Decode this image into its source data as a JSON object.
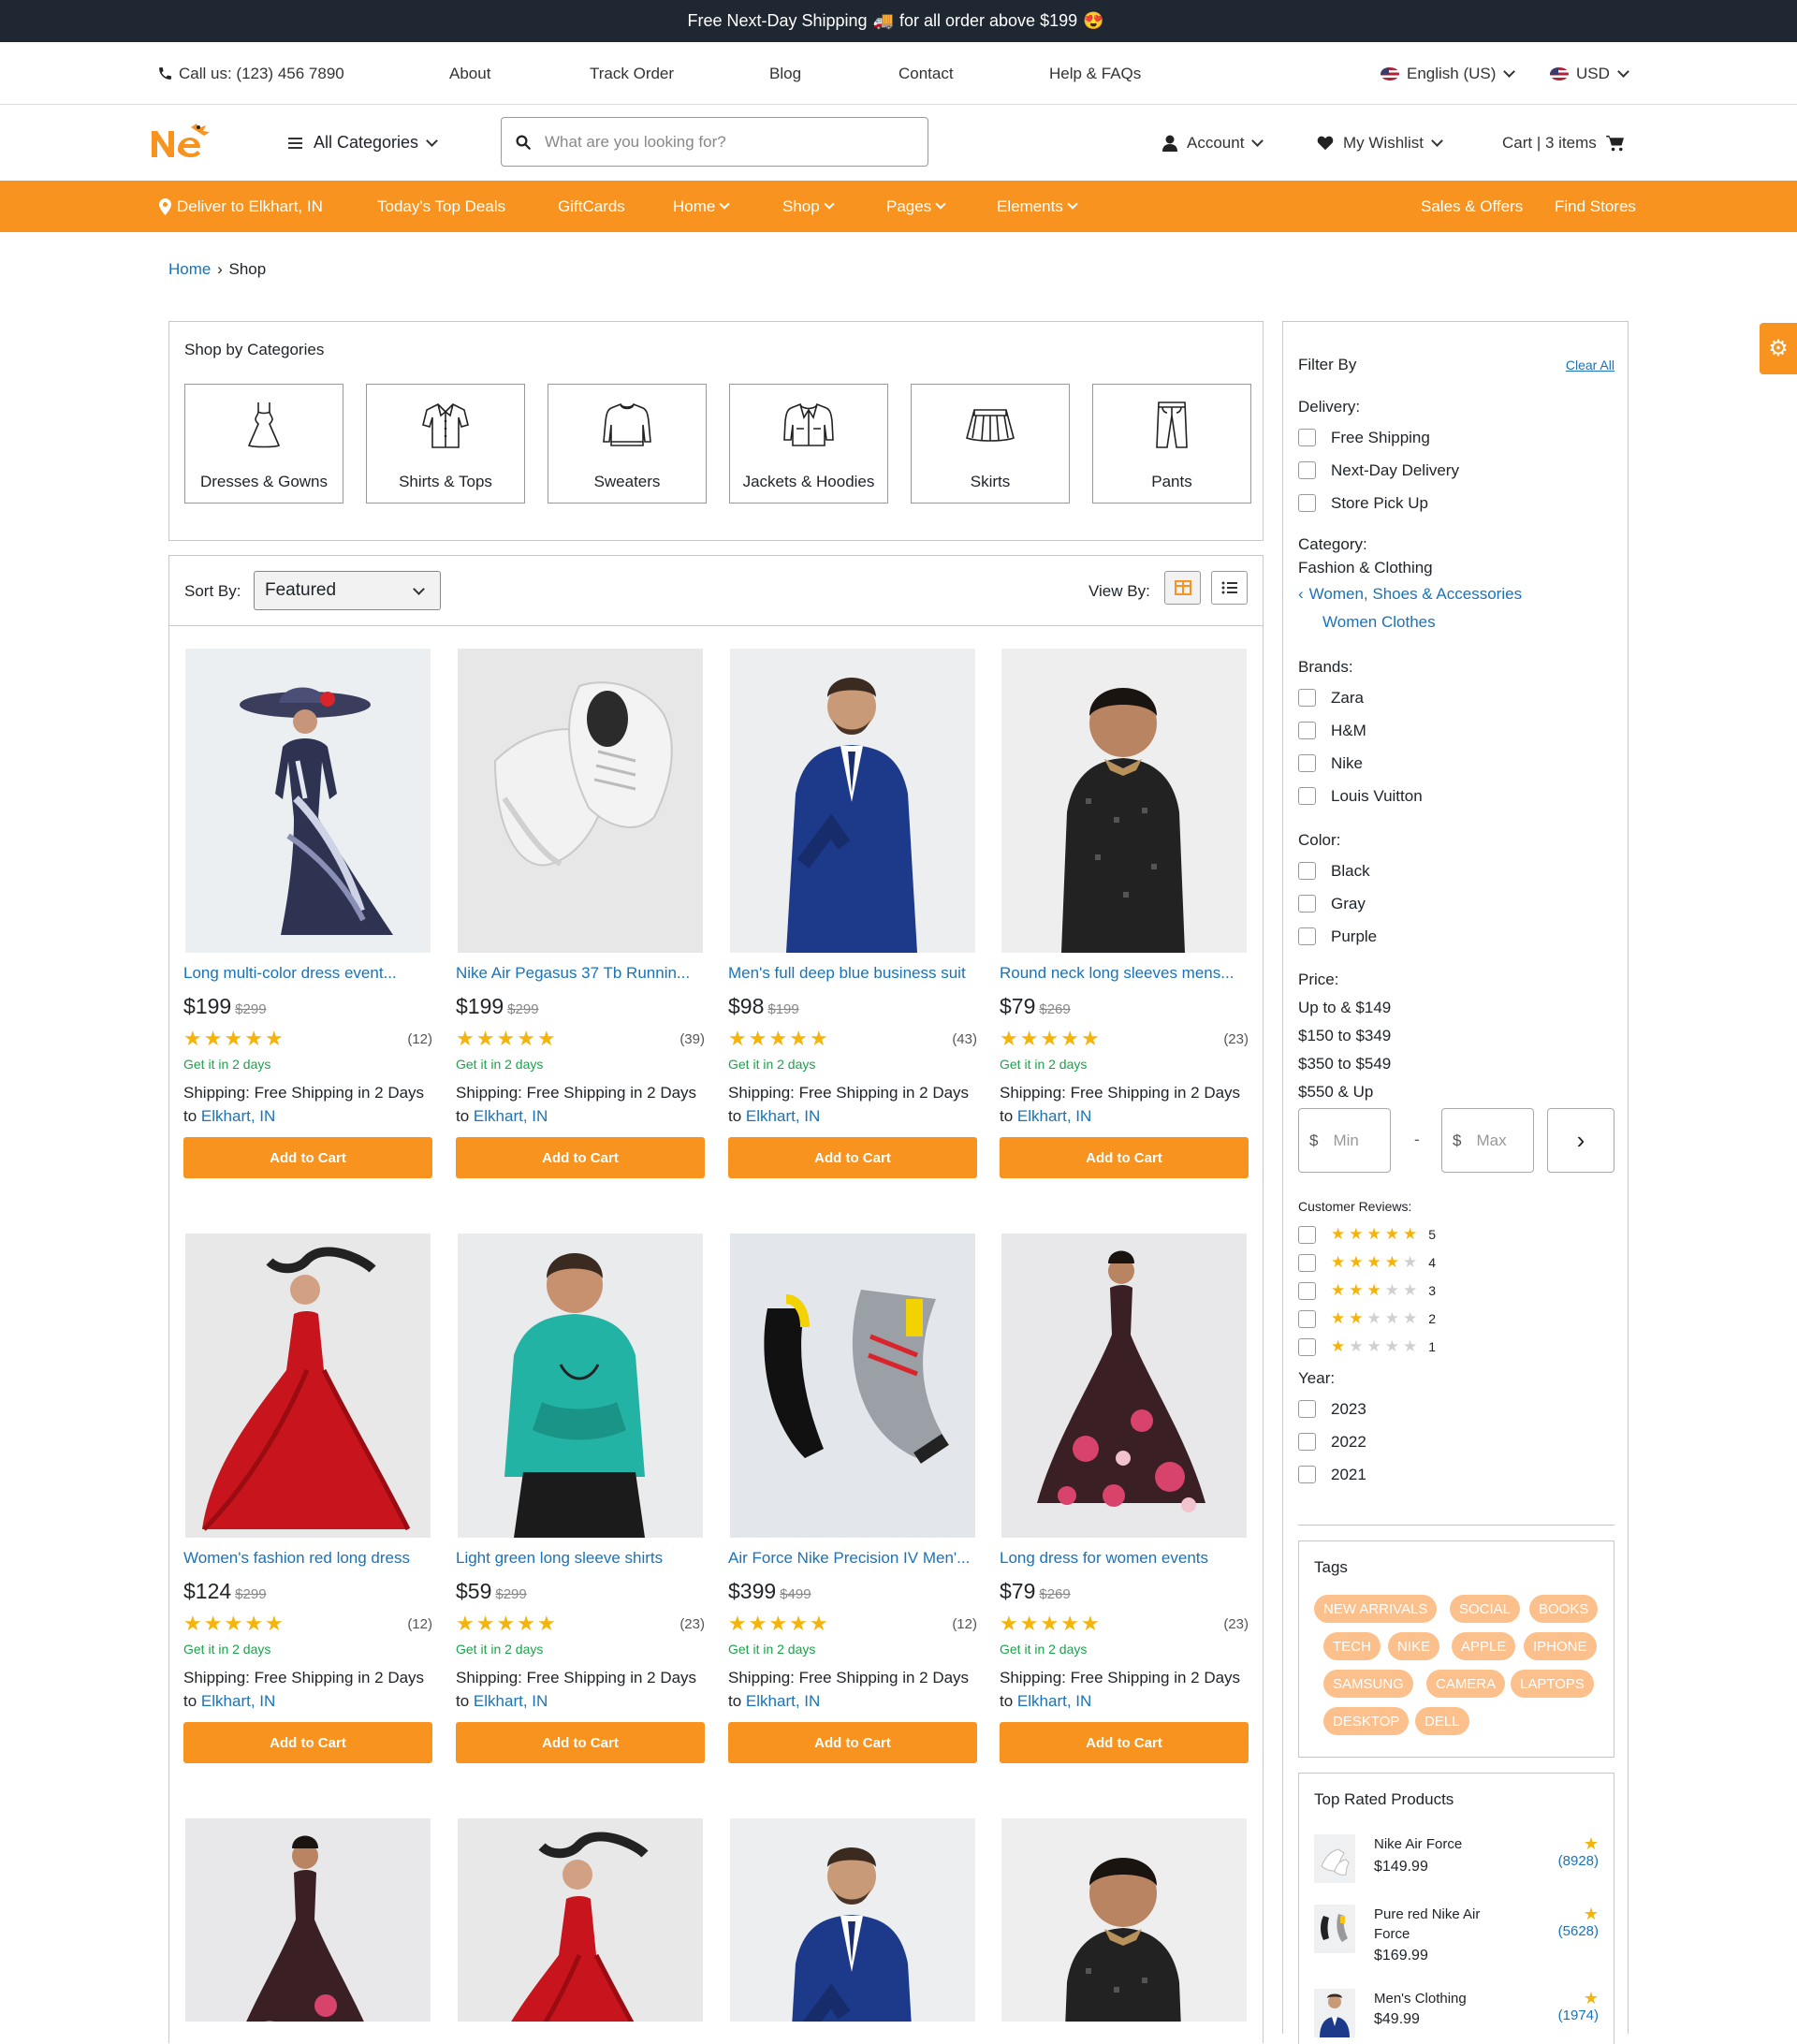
{
  "promo": {
    "text_a": "Free Next-Day Shipping",
    "text_b": "for all order above $199",
    "emoji_a": "🚚",
    "emoji_b": "😍"
  },
  "util": {
    "phone": "Call us: (123) 456 7890",
    "links": [
      "About",
      "Track Order",
      "Blog",
      "Contact",
      "Help & FAQs"
    ],
    "language": "English (US)",
    "currency": "USD"
  },
  "header": {
    "all_categories": "All Categories",
    "search_placeholder": "What are you looking for?",
    "account": "Account",
    "wishlist": "My Wishlist",
    "cart": "Cart | 3 items"
  },
  "nav": {
    "deliver": "Deliver to Elkhart, IN",
    "top_deals": "Today's Top Deals",
    "giftcards": "GiftCards",
    "home": "Home",
    "shop": "Shop",
    "pages": "Pages",
    "elements": "Elements",
    "sales": "Sales & Offers",
    "stores": "Find Stores"
  },
  "breadcrumb": {
    "home": "Home",
    "current": "Shop"
  },
  "categories": {
    "title": "Shop by Categories",
    "items": [
      "Dresses & Gowns",
      "Shirts & Tops",
      "Sweaters",
      "Jackets & Hoodies",
      "Skirts",
      "Pants"
    ]
  },
  "sort": {
    "label": "Sort By:",
    "value": "Featured",
    "view_label": "View By:"
  },
  "products": [
    {
      "title": "Long multi-color dress event...",
      "price": "$199",
      "old": "$299",
      "reviews": "(12)",
      "rating": 5,
      "eta": "Get it in 2 days",
      "ship_label": "Shipping:",
      "ship_text": "Free Shipping in 2 Days to",
      "loc": "Elkhart, IN",
      "btn": "Add to Cart"
    },
    {
      "title": "Nike Air Pegasus 37 Tb Runnin...",
      "price": "$199",
      "old": "$299",
      "reviews": "(39)",
      "rating": 5,
      "eta": "Get it in 2 days",
      "ship_label": "Shipping:",
      "ship_text": "Free Shipping in 2 Days to",
      "loc": "Elkhart, IN",
      "btn": "Add to Cart"
    },
    {
      "title": "Men's full deep blue business suit",
      "price": "$98",
      "old": "$199",
      "reviews": "(43)",
      "rating": 5,
      "eta": "Get it in 2 days",
      "ship_label": "Shipping:",
      "ship_text": "Free Shipping in 2 Days to",
      "loc": "Elkhart, IN",
      "btn": "Add to Cart"
    },
    {
      "title": "Round neck long sleeves mens...",
      "price": "$79",
      "old": "$269",
      "reviews": "(23)",
      "rating": 5,
      "eta": "Get it in 2 days",
      "ship_label": "Shipping:",
      "ship_text": "Free Shipping in 2 Days to",
      "loc": "Elkhart, IN",
      "btn": "Add to Cart"
    },
    {
      "title": "Women's fashion red long dress",
      "price": "$124",
      "old": "$299",
      "reviews": "(12)",
      "rating": 5,
      "eta": "Get it in 2 days",
      "ship_label": "Shipping:",
      "ship_text": "Free Shipping in 2 Days to",
      "loc": "Elkhart, IN",
      "btn": "Add to Cart"
    },
    {
      "title": "Light green long sleeve shirts",
      "price": "$59",
      "old": "$299",
      "reviews": "(23)",
      "rating": 5,
      "eta": "Get it in 2 days",
      "ship_label": "Shipping:",
      "ship_text": "Free Shipping in 2 Days to",
      "loc": "Elkhart, IN",
      "btn": "Add to Cart"
    },
    {
      "title": "Air Force Nike Precision IV Men'...",
      "price": "$399",
      "old": "$499",
      "reviews": "(12)",
      "rating": 5,
      "eta": "Get it in 2 days",
      "ship_label": "Shipping:",
      "ship_text": "Free Shipping in 2 Days to",
      "loc": "Elkhart, IN",
      "btn": "Add to Cart"
    },
    {
      "title": "Long dress for women events",
      "price": "$79",
      "old": "$269",
      "reviews": "(23)",
      "rating": 5,
      "eta": "Get it in 2 days",
      "ship_label": "Shipping:",
      "ship_text": "Free Shipping in 2 Days to",
      "loc": "Elkhart, IN",
      "btn": "Add to Cart"
    }
  ],
  "filter": {
    "title": "Filter By",
    "clear": "Clear All",
    "delivery_label": "Delivery:",
    "delivery": [
      "Free Shipping",
      "Next-Day Delivery",
      "Store Pick Up"
    ],
    "category_label": "Category:",
    "category_root": "Fashion & Clothing",
    "category_parent": "Women, Shoes & Accessories",
    "category_child": "Women Clothes",
    "brands_label": "Brands:",
    "brands": [
      "Zara",
      "H&M",
      "Nike",
      "Louis Vuitton"
    ],
    "color_label": "Color:",
    "colors": [
      "Black",
      "Gray",
      "Purple"
    ],
    "price_label": "Price:",
    "prices": [
      "Up to & $149",
      "$150 to $349",
      "$350 to $549",
      "$550 & Up"
    ],
    "min_placeholder": "Min",
    "max_placeholder": "Max",
    "currency": "$",
    "dash": "-",
    "reviews_label": "Customer Reviews:",
    "reviews": [
      5,
      4,
      3,
      2,
      1
    ],
    "year_label": "Year:",
    "years": [
      "2023",
      "2022",
      "2021"
    ]
  },
  "tags": {
    "title": "Tags",
    "items": [
      "NEW ARRIVALS",
      "SOCIAL",
      "BOOKS",
      "TECH",
      "NIKE",
      "APPLE",
      "IPHONE",
      "SAMSUNG",
      "CAMERA",
      "LAPTOPS",
      "DESKTOP",
      "DELL"
    ]
  },
  "top_rated": {
    "title": "Top Rated Products",
    "items": [
      {
        "name": "Nike Air Force",
        "price": "$149.99",
        "count": "(8928)"
      },
      {
        "name": "Pure red Nike Air Force",
        "price": "$169.99",
        "count": "(5628)"
      },
      {
        "name": "Men's Clothing",
        "price": "$49.99",
        "count": "(1974)"
      }
    ]
  },
  "colors": {
    "accent": "#f7931e",
    "dark": "#1f2733",
    "link": "#1a73b8",
    "green": "#1aa34a",
    "star": "#f5b40c"
  }
}
